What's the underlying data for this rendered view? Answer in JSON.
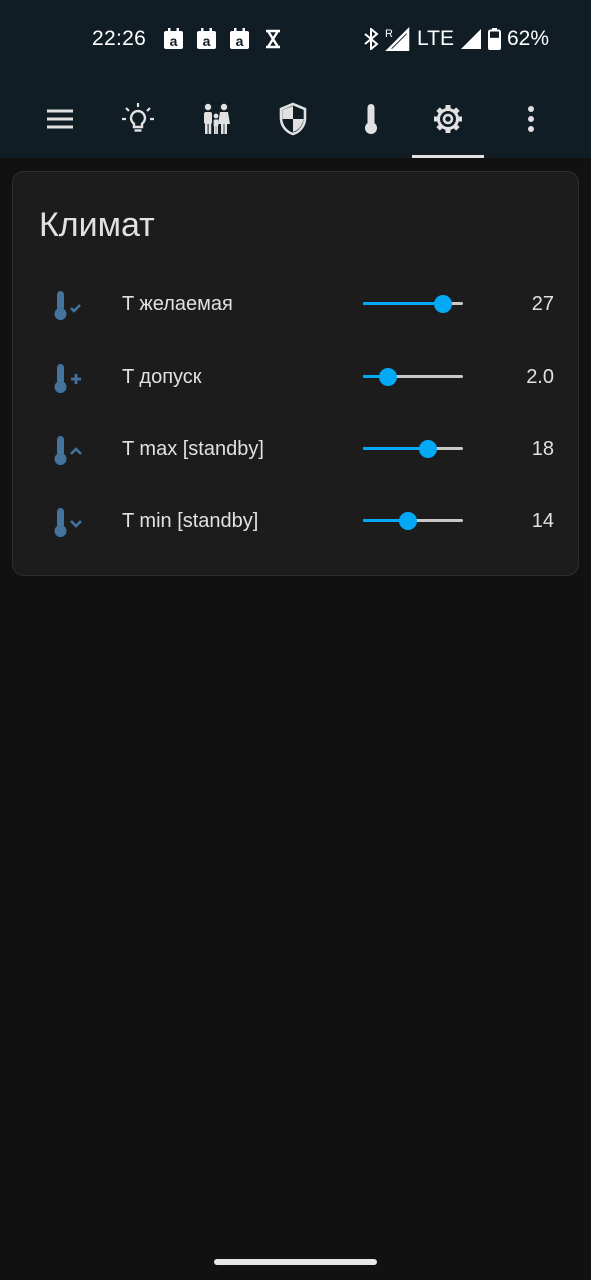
{
  "status_bar": {
    "time": "22:26",
    "notification_icons": [
      "amazon-calendar-icon",
      "amazon-calendar-icon",
      "amazon-calendar-icon",
      "hourglass-icon"
    ],
    "network": "LTE",
    "roaming_indicator": "R",
    "battery": "62%",
    "battery_level": 0.62
  },
  "toolbar": {
    "icons": [
      "menu-icon",
      "lightbulb-icon",
      "family-icon",
      "shield-icon",
      "thermometer-icon",
      "gear-icon",
      "more-vert-icon"
    ],
    "selected_tab": "gear-icon",
    "accent": "#03a9f4"
  },
  "card": {
    "title": "Климат",
    "rows": [
      {
        "icon": "thermometer-check-icon",
        "label": "T желаемая",
        "value": "27",
        "slider_level": 0.8
      },
      {
        "icon": "thermometer-plus-icon",
        "label": "T допуск",
        "value": "2.0",
        "slider_level": 0.25
      },
      {
        "icon": "thermometer-chevron-up-icon",
        "label": "T max [standby]",
        "value": "18",
        "slider_level": 0.65
      },
      {
        "icon": "thermometer-chevron-down-icon",
        "label": "T min [standby]",
        "value": "14",
        "slider_level": 0.45
      }
    ]
  },
  "colors": {
    "background": "#111111",
    "header": "#101d24",
    "card": "#1c1c1c",
    "icon": "#44739e",
    "slider": "#03a9f4"
  }
}
